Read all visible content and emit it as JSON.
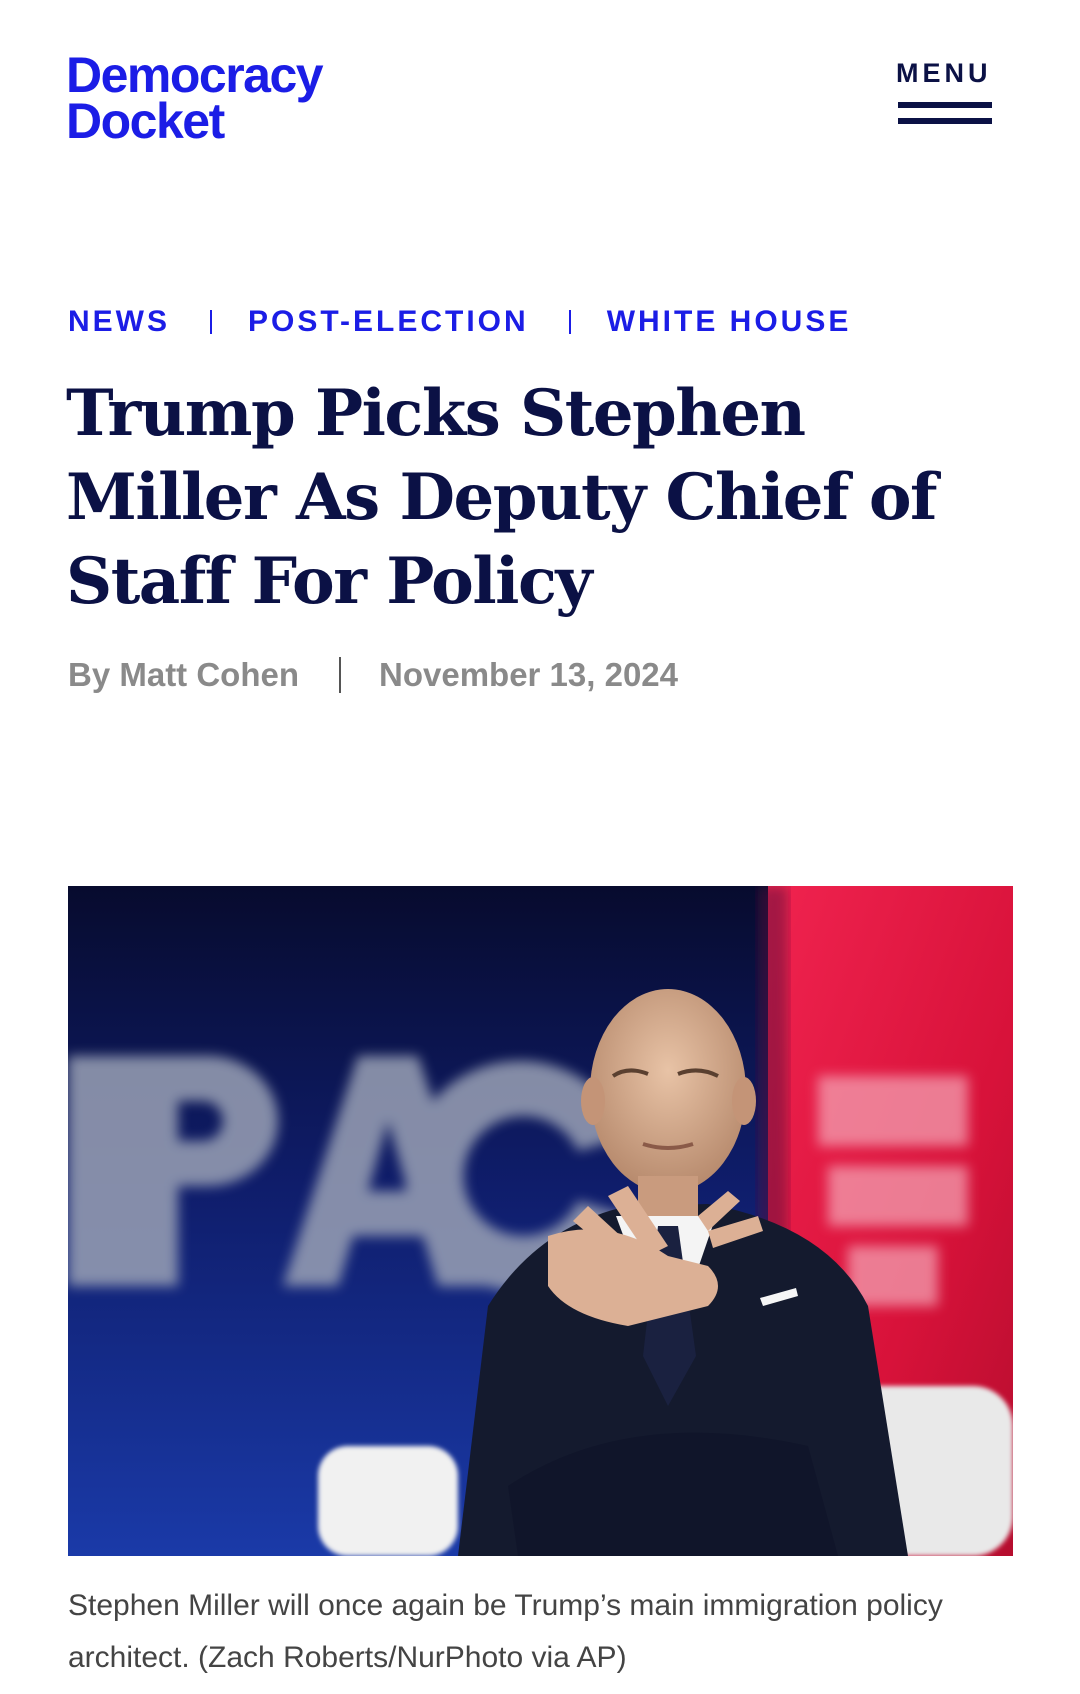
{
  "header": {
    "logo_line1": "Democracy",
    "logo_line2": "Docket",
    "menu_label": "MENU"
  },
  "colors": {
    "brand_blue": "#1b1de6",
    "navy": "#0b1145",
    "meta_gray": "#8a8a8a",
    "caption_gray": "#444444"
  },
  "categories": [
    {
      "label": "NEWS"
    },
    {
      "label": "POST-ELECTION"
    },
    {
      "label": "WHITE HOUSE"
    }
  ],
  "article": {
    "title": "Trump Picks Stephen Miller As Deputy Chief of Staff For Policy",
    "author": "By Matt Cohen",
    "date": "November 13, 2024",
    "image_caption": "Stephen Miller will once again be Trump’s main immigration policy architect. (Zach Roberts/NurPhoto via AP)"
  }
}
